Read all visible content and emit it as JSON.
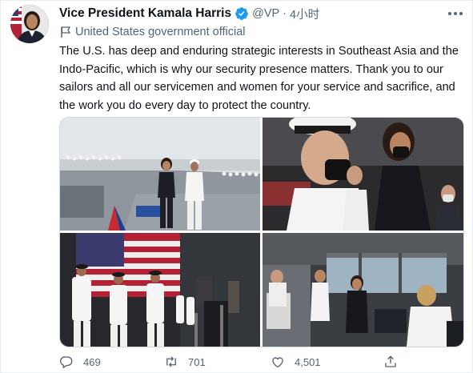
{
  "tweet": {
    "author_name": "Vice President Kamala Harris",
    "handle": "@VP",
    "separator": "·",
    "time": "4小时",
    "account_label": "United States government official",
    "text": "The U.S. has deep and enduring strategic interests in Southeast Asia and the Indo-Pacific, which is why our security presence matters. Thank you to our sailors and all our servicemen and women for your service and sacrifice, and the work you do every day to protect the country."
  },
  "actions": {
    "replies": "469",
    "retweets": "701",
    "likes": "4,501"
  },
  "colors": {
    "text_primary": "#0f1419",
    "text_secondary": "#536471",
    "verified_blue": "#1d9bf0",
    "border": "#cfd9de"
  },
  "icons": [
    "verified-icon",
    "more-icon",
    "government-flag-icon",
    "reply-icon",
    "retweet-icon",
    "like-icon",
    "share-icon"
  ]
}
